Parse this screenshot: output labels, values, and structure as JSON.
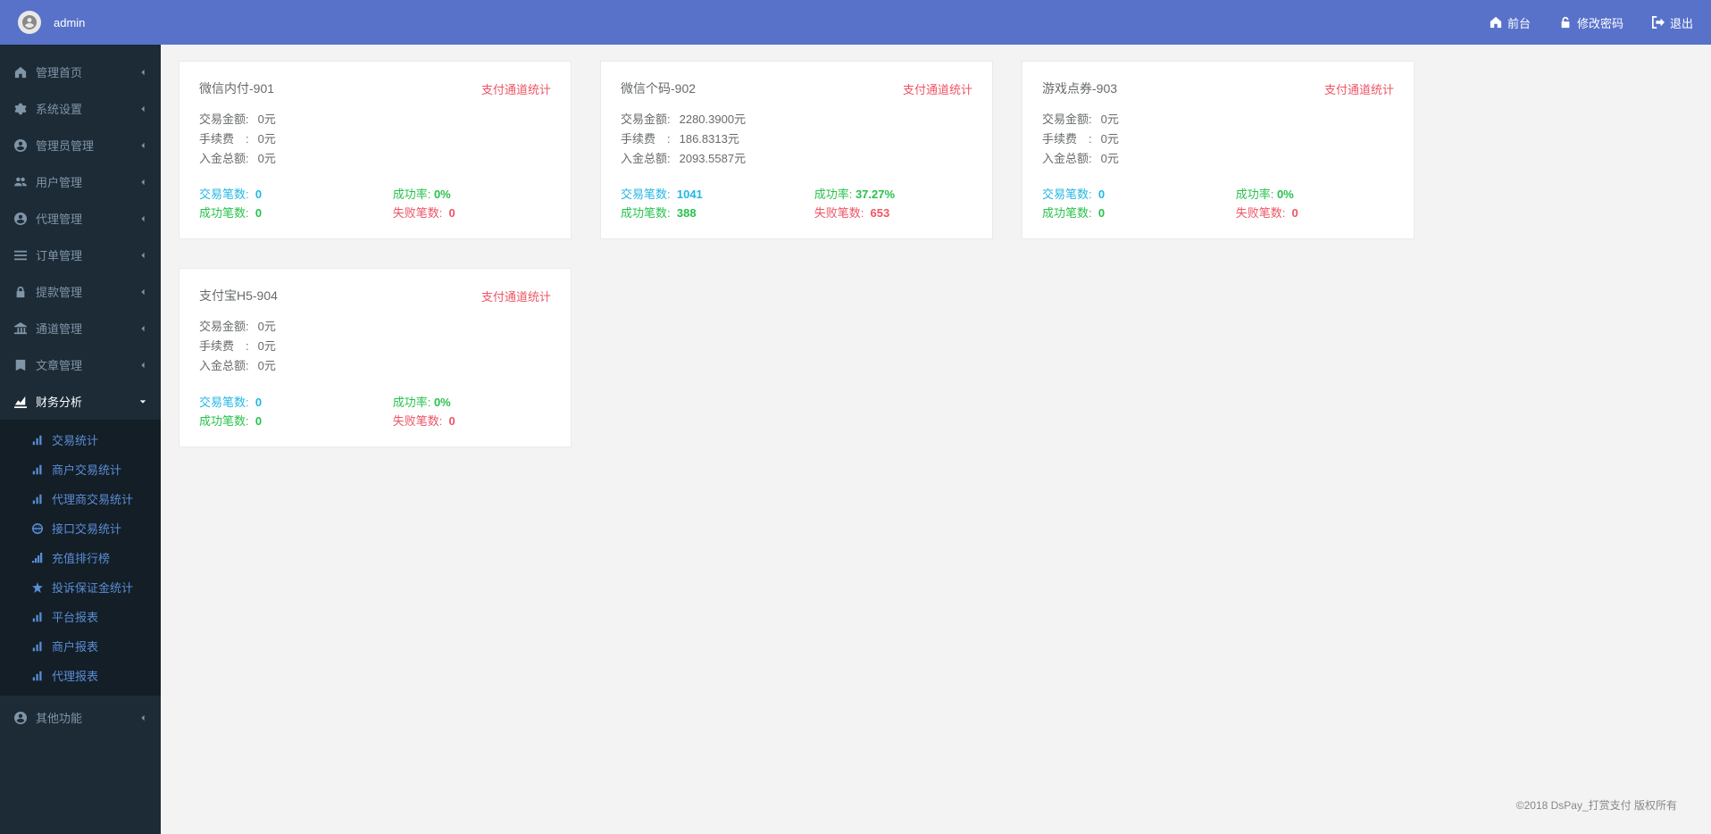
{
  "header": {
    "username": "admin",
    "links": {
      "front": "前台",
      "change_password": "修改密码",
      "logout": "退出"
    }
  },
  "sidebar": {
    "items": [
      {
        "icon": "home",
        "label": "管理首页"
      },
      {
        "icon": "cogs",
        "label": "系统设置"
      },
      {
        "icon": "user-circle",
        "label": "管理员管理"
      },
      {
        "icon": "users",
        "label": "用户管理"
      },
      {
        "icon": "user-circle",
        "label": "代理管理"
      },
      {
        "icon": "list",
        "label": "订单管理"
      },
      {
        "icon": "lock",
        "label": "提款管理"
      },
      {
        "icon": "bank",
        "label": "通道管理"
      },
      {
        "icon": "book",
        "label": "文章管理"
      }
    ],
    "active": {
      "icon": "chart",
      "label": "财务分析"
    },
    "sub_items": [
      {
        "icon": "bar",
        "label": "交易统计"
      },
      {
        "icon": "bar",
        "label": "商户交易统计"
      },
      {
        "icon": "bar",
        "label": "代理商交易统计"
      },
      {
        "icon": "globe",
        "label": "接口交易统计"
      },
      {
        "icon": "signal",
        "label": "充值排行榜"
      },
      {
        "icon": "star",
        "label": "投诉保证金统计"
      },
      {
        "icon": "bar",
        "label": "平台报表"
      },
      {
        "icon": "bar",
        "label": "商户报表"
      },
      {
        "icon": "bar",
        "label": "代理报表"
      }
    ],
    "other": {
      "icon": "user-circle",
      "label": "其他功能"
    }
  },
  "labels": {
    "tag": "支付通道统计",
    "trade_amount": "交易金额:",
    "fee": "手续费 :",
    "deposit_total": "入金总额:",
    "trade_count": "交易笔数:",
    "success_count": "成功笔数:",
    "success_rate": "成功率:",
    "fail_count": "失败笔数:"
  },
  "cards": [
    {
      "title": "微信内付-901",
      "trade_amount": "0元",
      "fee": "0元",
      "deposit_total": "0元",
      "trade_count": "0",
      "success_count": "0",
      "success_rate": "0%",
      "fail_count": "0"
    },
    {
      "title": "微信个码-902",
      "trade_amount": "2280.3900元",
      "fee": "186.8313元",
      "deposit_total": "2093.5587元",
      "trade_count": "1041",
      "success_count": "388",
      "success_rate": "37.27%",
      "fail_count": "653"
    },
    {
      "title": "游戏点券-903",
      "trade_amount": "0元",
      "fee": "0元",
      "deposit_total": "0元",
      "trade_count": "0",
      "success_count": "0",
      "success_rate": "0%",
      "fail_count": "0"
    },
    {
      "title": "支付宝H5-904",
      "trade_amount": "0元",
      "fee": "0元",
      "deposit_total": "0元",
      "trade_count": "0",
      "success_count": "0",
      "success_rate": "0%",
      "fail_count": "0"
    }
  ],
  "footer": "©2018 DsPay_打赏支付 版权所有"
}
